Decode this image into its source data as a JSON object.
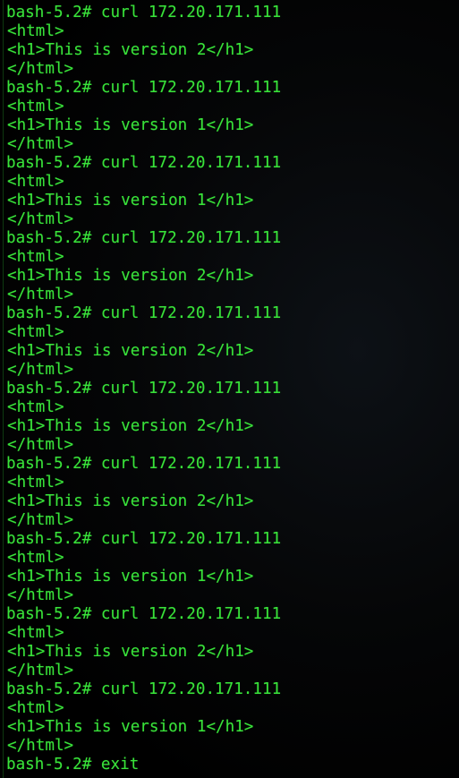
{
  "terminal": {
    "lines": [
      {
        "type": "prompt",
        "text": "bash-5.2# curl 172.20.171.111"
      },
      {
        "type": "output",
        "text": "<html>"
      },
      {
        "type": "output",
        "text": "<h1>This is version 2</h1>"
      },
      {
        "type": "output",
        "text": "</html>"
      },
      {
        "type": "prompt",
        "text": "bash-5.2# curl 172.20.171.111"
      },
      {
        "type": "output",
        "text": "<html>"
      },
      {
        "type": "output",
        "text": "<h1>This is version 1</h1>"
      },
      {
        "type": "output",
        "text": "</html>"
      },
      {
        "type": "prompt",
        "text": "bash-5.2# curl 172.20.171.111"
      },
      {
        "type": "output",
        "text": "<html>"
      },
      {
        "type": "output",
        "text": "<h1>This is version 1</h1>"
      },
      {
        "type": "output",
        "text": "</html>"
      },
      {
        "type": "prompt",
        "text": "bash-5.2# curl 172.20.171.111"
      },
      {
        "type": "output",
        "text": "<html>"
      },
      {
        "type": "output",
        "text": "<h1>This is version 2</h1>"
      },
      {
        "type": "output",
        "text": "</html>"
      },
      {
        "type": "prompt",
        "text": "bash-5.2# curl 172.20.171.111"
      },
      {
        "type": "output",
        "text": "<html>"
      },
      {
        "type": "output",
        "text": "<h1>This is version 2</h1>"
      },
      {
        "type": "output",
        "text": "</html>"
      },
      {
        "type": "prompt",
        "text": "bash-5.2# curl 172.20.171.111"
      },
      {
        "type": "output",
        "text": "<html>"
      },
      {
        "type": "output",
        "text": "<h1>This is version 2</h1>"
      },
      {
        "type": "output",
        "text": "</html>"
      },
      {
        "type": "prompt",
        "text": "bash-5.2# curl 172.20.171.111"
      },
      {
        "type": "output",
        "text": "<html>"
      },
      {
        "type": "output",
        "text": "<h1>This is version 2</h1>"
      },
      {
        "type": "output",
        "text": "</html>"
      },
      {
        "type": "prompt",
        "text": "bash-5.2# curl 172.20.171.111"
      },
      {
        "type": "output",
        "text": "<html>"
      },
      {
        "type": "output",
        "text": "<h1>This is version 1</h1>"
      },
      {
        "type": "output",
        "text": "</html>"
      },
      {
        "type": "prompt",
        "text": "bash-5.2# curl 172.20.171.111"
      },
      {
        "type": "output",
        "text": "<html>"
      },
      {
        "type": "output",
        "text": "<h1>This is version 2</h1>"
      },
      {
        "type": "output",
        "text": "</html>"
      },
      {
        "type": "prompt",
        "text": "bash-5.2# curl 172.20.171.111"
      },
      {
        "type": "output",
        "text": "<html>"
      },
      {
        "type": "output",
        "text": "<h1>This is version 1</h1>"
      },
      {
        "type": "output",
        "text": "</html>"
      },
      {
        "type": "prompt",
        "text": "bash-5.2# exit"
      }
    ],
    "colors": {
      "foreground": "#39e33a",
      "background": "#000000"
    }
  }
}
